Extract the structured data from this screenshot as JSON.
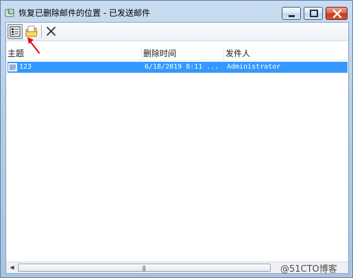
{
  "window": {
    "title": "恢复已删除邮件的位置 -  已发送邮件",
    "controls": {
      "minimize": "minimize",
      "maximize": "maximize",
      "close": "close"
    }
  },
  "toolbar": {
    "buttons": [
      {
        "icon": "list-view-icon",
        "pressed": true
      },
      {
        "icon": "restore-folder-icon",
        "pressed": false
      },
      {
        "icon": "delete-x-icon",
        "pressed": false
      }
    ]
  },
  "table": {
    "columns": [
      "主题",
      "删除时间",
      "发件人"
    ],
    "rows": [
      {
        "subject": "123",
        "deleted_time": "6/18/2019 8:11 ...",
        "sender": "Administrator",
        "selected": true,
        "icon": "mail-item-icon"
      }
    ]
  },
  "scrollbar": {
    "left_arrow": "◀",
    "right_arrow": "▶",
    "grip": "|||"
  },
  "watermark": "@51CTO博客",
  "colors": {
    "selection": "#3399ff",
    "arrow": "#e01010",
    "close_button": "#c43a1e"
  }
}
